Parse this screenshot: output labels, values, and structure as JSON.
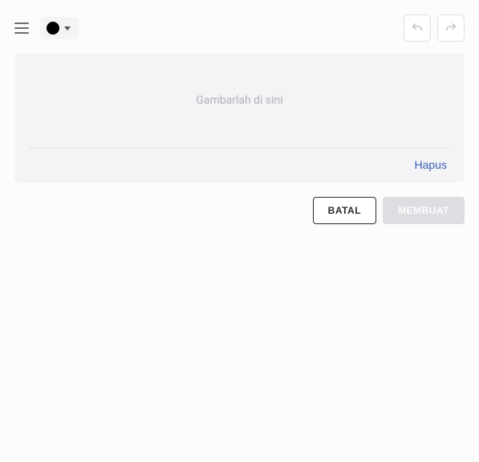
{
  "toolbar": {
    "selected_color": "#000000"
  },
  "canvas": {
    "placeholder": "Gambarlah di sini",
    "clear_label": "Hapus"
  },
  "actions": {
    "cancel_label": "BATAL",
    "create_label": "MEMBUAT"
  }
}
